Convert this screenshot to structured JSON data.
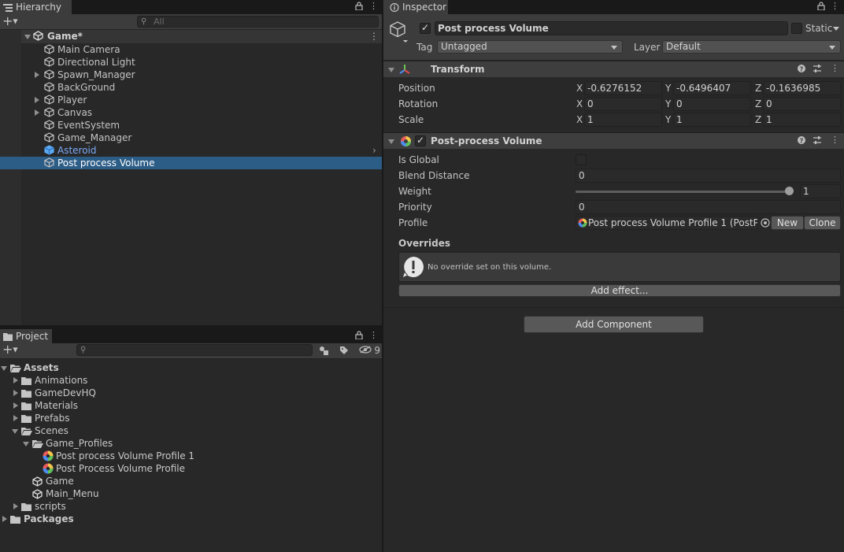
{
  "hierarchy": {
    "tab_label": "Hierarchy",
    "search_placeholder": "All",
    "scene_name": "Game*",
    "items": [
      {
        "label": "Main Camera",
        "expandable": false,
        "color": "#c4c4c4"
      },
      {
        "label": "Directional Light",
        "expandable": false,
        "color": "#c4c4c4"
      },
      {
        "label": "Spawn_Manager",
        "expandable": true,
        "color": "#c4c4c4"
      },
      {
        "label": "BackGround",
        "expandable": false,
        "color": "#c4c4c4"
      },
      {
        "label": "Player",
        "expandable": true,
        "color": "#c4c4c4"
      },
      {
        "label": "Canvas",
        "expandable": true,
        "color": "#c4c4c4"
      },
      {
        "label": "EventSystem",
        "expandable": false,
        "color": "#c4c4c4"
      },
      {
        "label": "Game_Manager",
        "expandable": false,
        "color": "#c4c4c4"
      },
      {
        "label": "Asteroid",
        "expandable": false,
        "color": "#7baaf7",
        "prefab": true
      },
      {
        "label": "Post process Volume",
        "expandable": false,
        "color": "#ffffff",
        "selected": true
      }
    ]
  },
  "project": {
    "tab_label": "Project",
    "hidden_count": "9",
    "tree": [
      {
        "label": "Assets",
        "indent": 0,
        "arrow": "down",
        "icon": "folder-open",
        "bold": true
      },
      {
        "label": "Animations",
        "indent": 1,
        "arrow": "right",
        "icon": "folder"
      },
      {
        "label": "GameDevHQ",
        "indent": 1,
        "arrow": "right",
        "icon": "folder"
      },
      {
        "label": "Materials",
        "indent": 1,
        "arrow": "right",
        "icon": "folder"
      },
      {
        "label": "Prefabs",
        "indent": 1,
        "arrow": "right",
        "icon": "folder"
      },
      {
        "label": "Scenes",
        "indent": 1,
        "arrow": "down",
        "icon": "folder-open"
      },
      {
        "label": "Game_Profiles",
        "indent": 2,
        "arrow": "down",
        "icon": "folder-open"
      },
      {
        "label": "Post process Volume Profile 1",
        "indent": 3,
        "arrow": "",
        "icon": "profile"
      },
      {
        "label": "Post Process Volume Profile",
        "indent": 3,
        "arrow": "",
        "icon": "profile"
      },
      {
        "label": "Game",
        "indent": 2,
        "arrow": "",
        "icon": "unity"
      },
      {
        "label": "Main_Menu",
        "indent": 2,
        "arrow": "",
        "icon": "unity"
      },
      {
        "label": "scripts",
        "indent": 1,
        "arrow": "right",
        "icon": "folder"
      },
      {
        "label": "Packages",
        "indent": 0,
        "arrow": "right",
        "icon": "folder",
        "bold": true
      }
    ]
  },
  "inspector": {
    "tab_label": "Inspector",
    "object_name": "Post process Volume",
    "static_label": "Static",
    "tag_label": "Tag",
    "tag_value": "Untagged",
    "layer_label": "Layer",
    "layer_value": "Default",
    "transform": {
      "title": "Transform",
      "position_label": "Position",
      "rotation_label": "Rotation",
      "scale_label": "Scale",
      "position": {
        "x": "-0.6276152",
        "y": "-0.6496407",
        "z": "-0.1636985"
      },
      "rotation": {
        "x": "0",
        "y": "0",
        "z": "0"
      },
      "scale": {
        "x": "1",
        "y": "1",
        "z": "1"
      },
      "x_label": "X",
      "y_label": "Y",
      "z_label": "Z"
    },
    "ppv": {
      "title": "Post-process Volume",
      "is_global_label": "Is Global",
      "blend_distance_label": "Blend Distance",
      "blend_distance_value": "0",
      "weight_label": "Weight",
      "weight_value": "1",
      "weight_fraction": 1.0,
      "priority_label": "Priority",
      "priority_value": "0",
      "profile_label": "Profile",
      "profile_value": "Post process Volume Profile 1 (PostPro",
      "new_label": "New",
      "clone_label": "Clone",
      "overrides_label": "Overrides",
      "no_override_msg": "No override set on this volume.",
      "add_effect_label": "Add effect..."
    },
    "add_component_label": "Add Component"
  }
}
